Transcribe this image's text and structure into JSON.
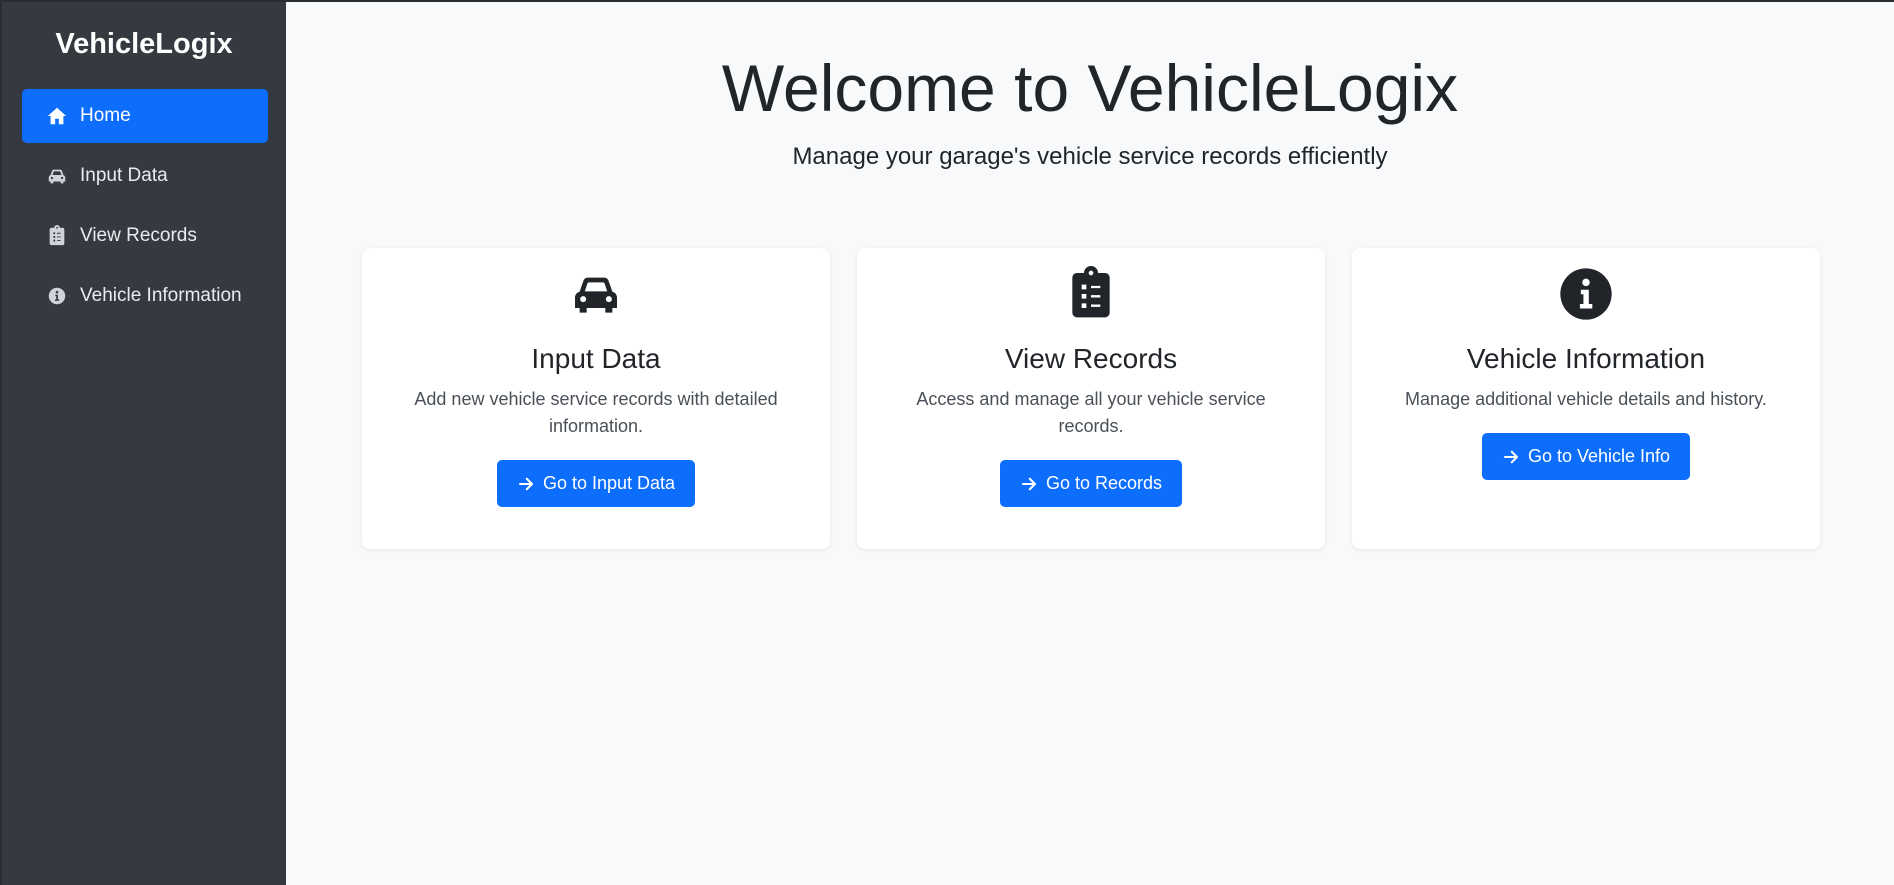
{
  "app": {
    "brand": "VehicleLogix"
  },
  "sidebar": {
    "items": [
      {
        "label": "Home",
        "icon": "home-icon",
        "active": true
      },
      {
        "label": "Input Data",
        "icon": "car-icon",
        "active": false
      },
      {
        "label": "View Records",
        "icon": "clipboard-list-icon",
        "active": false
      },
      {
        "label": "Vehicle Information",
        "icon": "info-circle-icon",
        "active": false
      }
    ]
  },
  "main": {
    "title": "Welcome to VehicleLogix",
    "subtitle": "Manage your garage's vehicle service records efficiently",
    "cards": [
      {
        "icon": "car-icon",
        "title": "Input Data",
        "text": "Add new vehicle service records with detailed information.",
        "button": "Go to Input Data"
      },
      {
        "icon": "clipboard-list-icon",
        "title": "View Records",
        "text": "Access and manage all your vehicle service records.",
        "button": "Go to Records"
      },
      {
        "icon": "info-circle-icon",
        "title": "Vehicle Information",
        "text": "Manage additional vehicle details and history.",
        "button": "Go to Vehicle Info"
      }
    ]
  },
  "colors": {
    "primary": "#0d6efd",
    "sidebar_bg": "#343a40",
    "page_bg": "#f8f9fa"
  }
}
